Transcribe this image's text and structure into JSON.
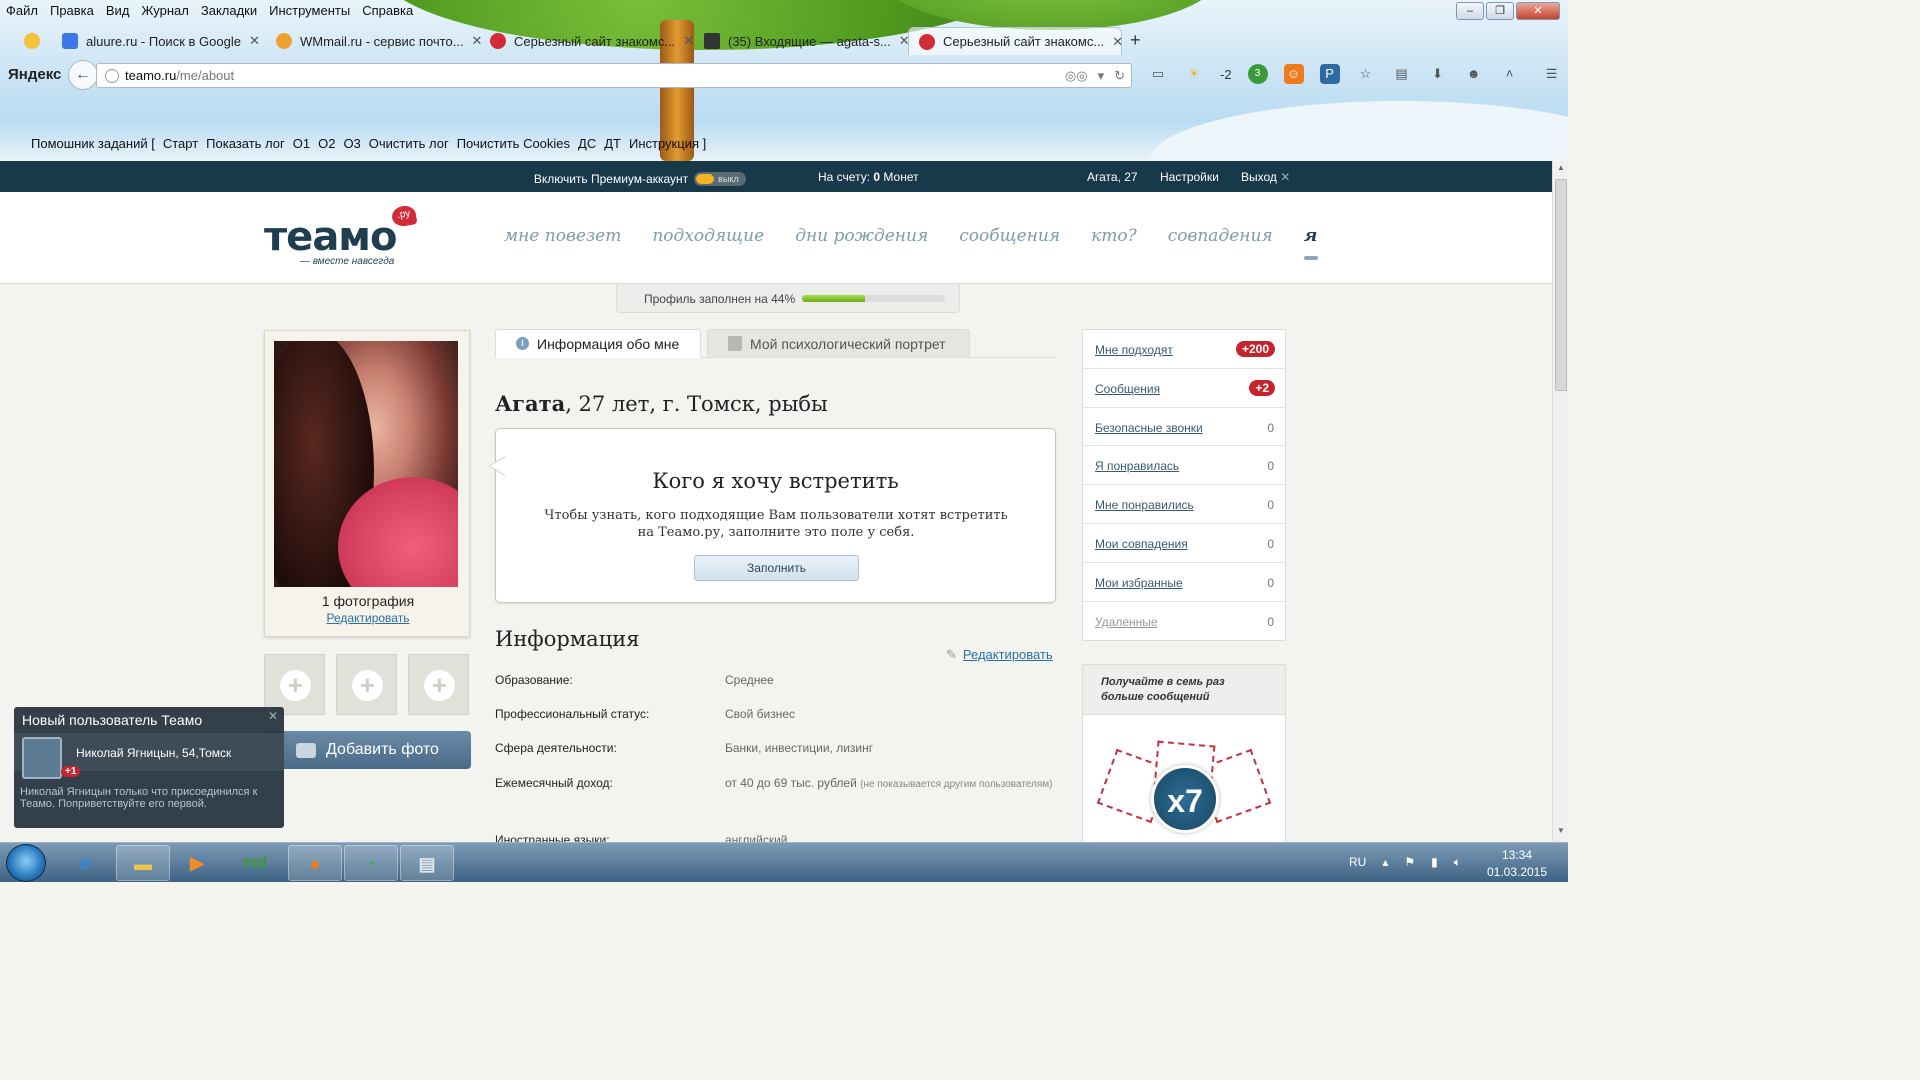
{
  "browser": {
    "menu": [
      "Файл",
      "Правка",
      "Вид",
      "Журнал",
      "Закладки",
      "Инструменты",
      "Справка"
    ],
    "tabs": [
      {
        "label": "aluure.ru - Поиск в Google",
        "color": "#3b78e7"
      },
      {
        "label": "WMmail.ru - сервис почто...",
        "color": "#f0a030"
      },
      {
        "label": "Серьезный сайт знакомс...",
        "color": "#d42b39"
      },
      {
        "label": "(35) Входящие — agata-s...",
        "color": "#333333"
      },
      {
        "label": "Серьезный сайт знакомс...",
        "color": "#d42b39"
      }
    ],
    "yandex_label": "Яндекс",
    "url_host": "teamo.ru",
    "url_path": "/me/about",
    "weather": "-2",
    "assist_bar": [
      "Помошник заданий [",
      "Старт",
      "Показать лог",
      "O1",
      "O2",
      "O3",
      "Очистить лог",
      "Почистить Cookies",
      "ДС",
      "ДТ",
      "Инструкция ]"
    ]
  },
  "topbar": {
    "premium_label": "Включить Премиум-аккаунт",
    "toggle_label": "выкл",
    "balance_prefix": "На счету:",
    "balance_value": "0",
    "balance_suffix": "Монет",
    "user": "Агата, 27",
    "settings": "Настройки",
    "logout": "Выход"
  },
  "header": {
    "logo": "теамо",
    "logo_badge": ".ру",
    "tagline": "— вместе навсегда",
    "nav": [
      "мне повезет",
      "подходящие",
      "дни рождения",
      "сообщения",
      "кто?",
      "совпадения",
      "я"
    ]
  },
  "progress": {
    "label": "Профиль заполнен на 44%",
    "value": 0.44
  },
  "profile": {
    "photo_count": "1 фотография",
    "photo_edit": "Редактировать",
    "add_photo": "Добавить фото",
    "tab_about": "Информация обо мне",
    "tab_portrait": "Мой психологический портрет",
    "name": "Агата",
    "details": ", 27 лет, г. Томск, рыбы",
    "meet_title": "Кого я хочу встретить",
    "meet_text": "Чтобы узнать, кого подходящие Вам пользователи хотят встретить на Теамо.ру, заполните это поле у себя.",
    "fill_button": "Заполнить",
    "info_title": "Информация",
    "info_edit": "Редактировать",
    "info_rows": [
      {
        "label": "Образование:",
        "value": "Среднее",
        "note": ""
      },
      {
        "label": "Профессиональный статус:",
        "value": "Свой бизнес",
        "note": ""
      },
      {
        "label": "Сфера деятельности:",
        "value": "Банки, инвестиции, лизинг",
        "note": ""
      },
      {
        "label": "Ежемесячный доход:",
        "value": "от 40 до 69 тыс. рублей",
        "note": "(не показывается другим пользователям)"
      },
      {
        "label": "Иностранные языки:",
        "value": "английский",
        "note": ""
      }
    ]
  },
  "sidebar": {
    "items": [
      {
        "label": "Мне подходят",
        "badge": "+200",
        "count": ""
      },
      {
        "label": "Сообщения",
        "badge": "+2",
        "count": ""
      },
      {
        "label": "Безопасные звонки",
        "badge": "",
        "count": "0"
      },
      {
        "label": "Я понравилась",
        "badge": "",
        "count": "0"
      },
      {
        "label": "Мне понравились",
        "badge": "",
        "count": "0"
      },
      {
        "label": "Мои совпадения",
        "badge": "",
        "count": "0"
      },
      {
        "label": "Мои избранные",
        "badge": "",
        "count": "0"
      },
      {
        "label": "Удаленные",
        "badge": "",
        "count": "0"
      }
    ],
    "promo_text": "Получайте в семь раз больше сообщений",
    "promo_badge": "x7"
  },
  "notification": {
    "title": "Новый пользователь Теамо",
    "badge": "+1",
    "who": "Николай Ягницын, 54,Томск",
    "text": "Николай Ягницын только что присоединился к Теамо. Поприветствуйте его первой."
  },
  "taskbar": {
    "lang": "RU",
    "time": "13:34",
    "date": "01.03.2015"
  }
}
